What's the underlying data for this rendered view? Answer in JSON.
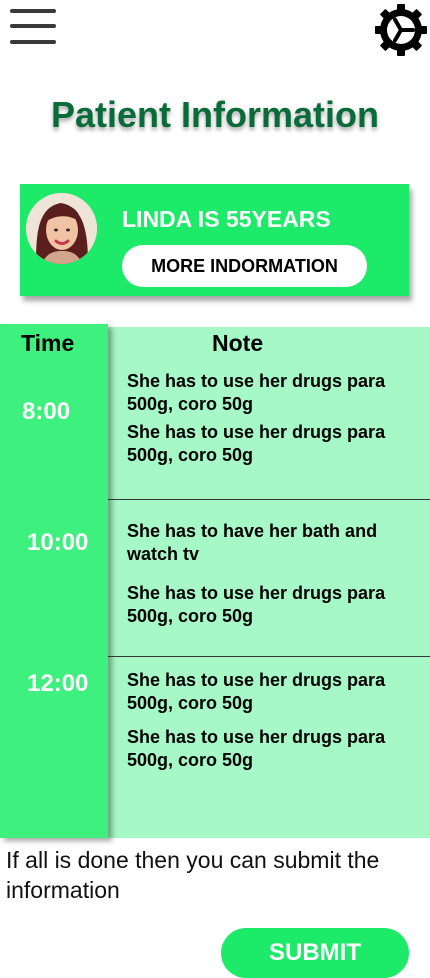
{
  "header": {
    "menu_icon": "hamburger-menu-icon",
    "settings_icon": "gear-icon"
  },
  "page": {
    "title": "Patient Information"
  },
  "patient_card": {
    "name": "LINDA IS 55YEARS",
    "more_button": "MORE INDORMATION",
    "avatar": "patient-photo"
  },
  "schedule": {
    "time_header": "Time",
    "note_header": "Note",
    "slots": [
      {
        "time": "8:00",
        "notes": [
          "She has to use her drugs para 500g, coro 50g",
          "She has to use her drugs para 500g, coro 50g"
        ]
      },
      {
        "time": "10:00",
        "notes": [
          "She has to have her bath and watch tv",
          "She has to use her drugs para 500g, coro 50g"
        ]
      },
      {
        "time": "12:00",
        "notes": [
          "She has to use her drugs para 500g, coro 50g",
          "She has to use her drugs para 500g, coro 50g"
        ]
      }
    ]
  },
  "footer": {
    "info_text": "If all is done then you can submit the information",
    "submit_label": "SUBMIT"
  },
  "colors": {
    "accent_green": "#1eea6a",
    "time_column_green": "#3ef07e",
    "notes_background": "#a6f8c6",
    "title_green": "#0a6b3a"
  }
}
